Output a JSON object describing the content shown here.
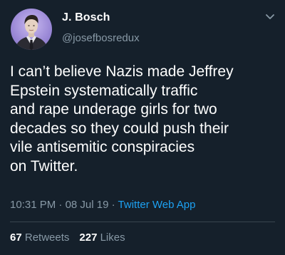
{
  "user": {
    "display_name": "J. Bosch",
    "handle": "@josefbosredux",
    "avatar_icon": "profile-photo"
  },
  "tweet": {
    "lines": [
      "I can’t believe Nazis made Jeffrey",
      "Epstein systematically traffic",
      "and rape underage girls for two",
      "decades so they could push their",
      "vile antisemitic conspiracies",
      "on Twitter."
    ],
    "time": "10:31 PM",
    "date": "08 Jul 19",
    "separator": "·",
    "source": "Twitter Web App"
  },
  "stats": {
    "retweets_count": "67",
    "retweets_label": "Retweets",
    "likes_count": "227",
    "likes_label": "Likes"
  },
  "colors": {
    "background": "#15202b",
    "secondary_text": "#8899a6",
    "link": "#1da1f2",
    "divider": "#38444d"
  },
  "icons": {
    "menu": "chevron-down-icon"
  }
}
